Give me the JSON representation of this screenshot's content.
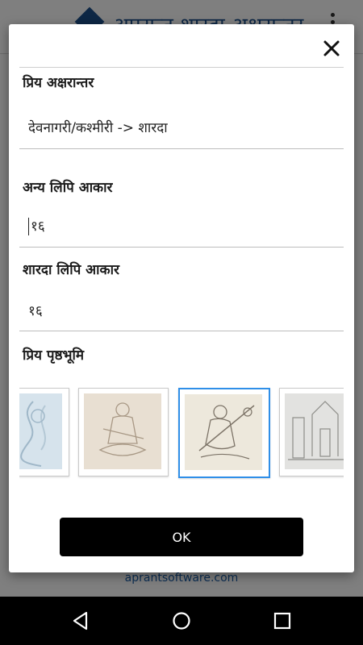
{
  "background": {
    "app_title": "अपरान्त शारदा अक्षरान्तर",
    "footer_link": "aprantsoftware.com"
  },
  "dialog": {
    "sections": {
      "transliteration_label": "प्रिय अक्षरान्तर",
      "transliteration_value": "देवनागरी/कश्मीरी -> शारदा",
      "other_script_size_label": "अन्य लिपि आकार",
      "other_script_size_value": "१६",
      "sharada_size_label": "शारदा लिपि आकार",
      "sharada_size_value": "१६",
      "background_label": "प्रिय पृष्ठभूमि"
    },
    "backgrounds": [
      {
        "name": "blue-sketch",
        "selected": false
      },
      {
        "name": "goddess-on-lotus-sketch",
        "selected": false
      },
      {
        "name": "goddess-with-veena-sketch",
        "selected": true
      },
      {
        "name": "temple-ruins-sketch",
        "selected": false
      }
    ],
    "ok_label": "OK"
  },
  "colors": {
    "accent_selected": "#2f8fe8",
    "ok_button": "#000000",
    "link": "#1b5fa8"
  },
  "navbar": {
    "icons": [
      "back-icon",
      "home-icon",
      "recents-icon"
    ]
  }
}
